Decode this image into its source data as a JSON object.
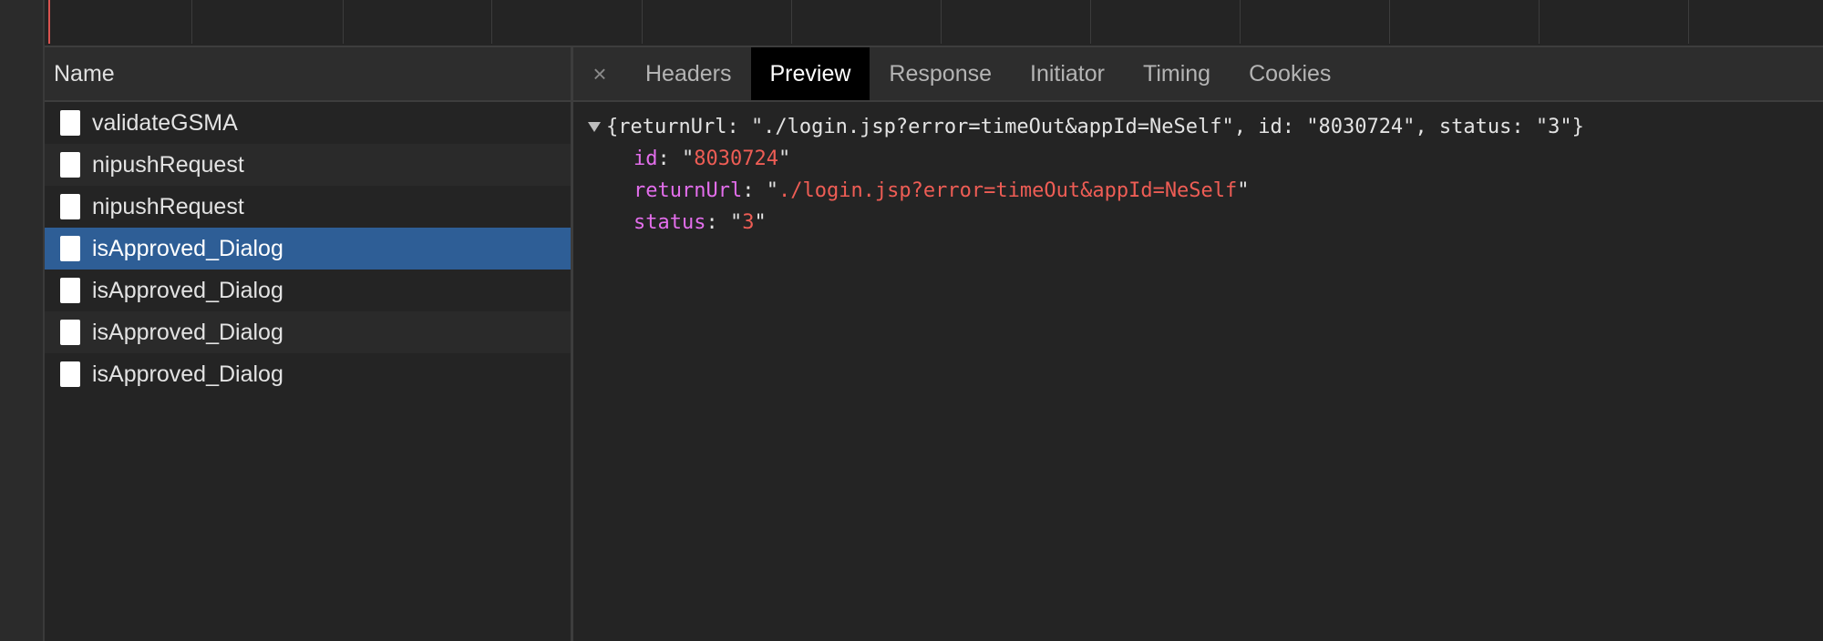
{
  "name_panel": {
    "header": "Name",
    "requests": [
      {
        "name": "validateGSMA",
        "selected": false
      },
      {
        "name": "nipushRequest",
        "selected": false
      },
      {
        "name": "nipushRequest",
        "selected": false
      },
      {
        "name": "isApproved_Dialog",
        "selected": true
      },
      {
        "name": "isApproved_Dialog",
        "selected": false
      },
      {
        "name": "isApproved_Dialog",
        "selected": false
      },
      {
        "name": "isApproved_Dialog",
        "selected": false
      }
    ]
  },
  "detail": {
    "close_glyph": "×",
    "tabs": [
      {
        "label": "Headers",
        "active": false
      },
      {
        "label": "Preview",
        "active": true
      },
      {
        "label": "Response",
        "active": false
      },
      {
        "label": "Initiator",
        "active": false
      },
      {
        "label": "Timing",
        "active": false
      },
      {
        "label": "Cookies",
        "active": false
      }
    ],
    "preview": {
      "summary": "{returnUrl: \"./login.jsp?error=timeOut&appId=NeSelf\", id: \"8030724\", status: \"3\"}",
      "properties": [
        {
          "key": "id",
          "value": "8030724"
        },
        {
          "key": "returnUrl",
          "value": "./login.jsp?error=timeOut&appId=NeSelf"
        },
        {
          "key": "status",
          "value": "3"
        }
      ]
    }
  },
  "colors": {
    "selected_row": "#2e5e96",
    "json_key": "#e36eec",
    "json_string": "#ee5d55",
    "active_tab": "#000000"
  }
}
